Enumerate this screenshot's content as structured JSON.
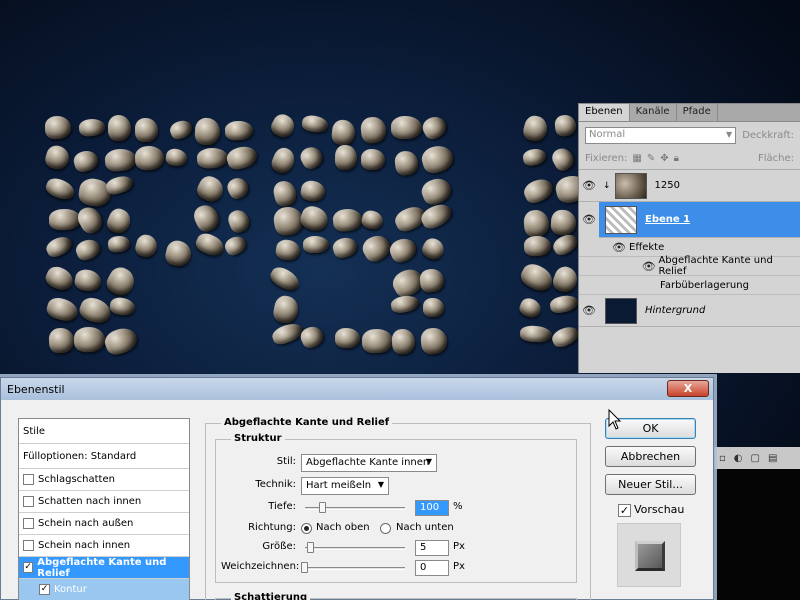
{
  "canvas": {
    "text": "PSD"
  },
  "layers_panel": {
    "tabs": [
      "Ebenen",
      "Kanäle",
      "Pfade"
    ],
    "active_tab": "Ebenen",
    "blend_mode": "Normal",
    "opacity_label": "Deckkraft:",
    "lock_label": "Fixieren:",
    "fill_label": "Fläche:",
    "layers": [
      {
        "name": "1250",
        "visible": true,
        "selected": false
      },
      {
        "name": "Ebene 1",
        "visible": true,
        "selected": true
      },
      {
        "name": "Effekte"
      },
      {
        "name": "Abgeflachte Kante und Relief"
      },
      {
        "name": "Farbüberlagerung"
      },
      {
        "name": "Hintergrund",
        "visible": true,
        "selected": false
      }
    ]
  },
  "dialog": {
    "title": "Ebenenstil",
    "close_label": "X",
    "styles": [
      {
        "label": "Stile",
        "checked": null
      },
      {
        "label": "Fülloptionen: Standard",
        "checked": null
      },
      {
        "label": "Schlagschatten",
        "checked": false
      },
      {
        "label": "Schatten nach innen",
        "checked": false
      },
      {
        "label": "Schein nach außen",
        "checked": false
      },
      {
        "label": "Schein nach innen",
        "checked": false
      },
      {
        "label": "Abgeflachte Kante und Relief",
        "checked": true
      },
      {
        "label": "Kontur",
        "checked": true
      }
    ],
    "section_title": "Abgeflachte Kante und Relief",
    "structure_title": "Struktur",
    "fields": {
      "stil_label": "Stil:",
      "stil_value": "Abgeflachte Kante innen",
      "technik_label": "Technik:",
      "technik_value": "Hart meißeln",
      "tiefe_label": "Tiefe:",
      "tiefe_value": "100",
      "tiefe_unit": "%",
      "richtung_label": "Richtung:",
      "richtung_up": "Nach oben",
      "richtung_down": "Nach unten",
      "groesse_label": "Größe:",
      "groesse_value": "5",
      "groesse_unit": "Px",
      "weich_label": "Weichzeichnen:",
      "weich_value": "0",
      "weich_unit": "Px"
    },
    "shading_title": "Schattierung",
    "buttons": {
      "ok": "OK",
      "cancel": "Abbrechen",
      "new_style": "Neuer Stil...",
      "preview": "Vorschau"
    },
    "preview_checked": true
  }
}
